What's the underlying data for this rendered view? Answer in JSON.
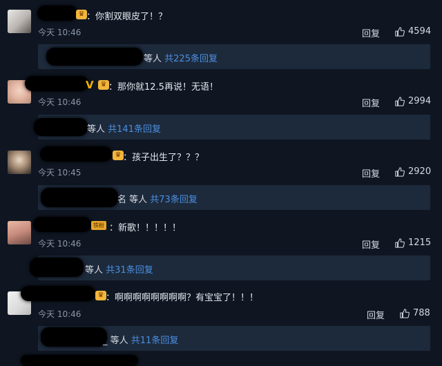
{
  "comments": [
    {
      "text": "：你割双眼皮了！？",
      "time": "今天 10:46",
      "reply_label": "回复",
      "likes": "4594",
      "thread": {
        "prefix": "等人",
        "count_text": "共225条回复"
      }
    },
    {
      "vip_mark": "V",
      "text": "：那你就12.5再说！无语！",
      "time": "今天 10:46",
      "reply_label": "回复",
      "likes": "2994",
      "thread": {
        "prefix": "等人",
        "count_text": "共141条回复"
      }
    },
    {
      "text": "：孩子出生了？？？",
      "time": "今天 10:45",
      "reply_label": "回复",
      "likes": "2920",
      "thread": {
        "prefix": "名 等人",
        "count_text": "共73条回复"
      }
    },
    {
      "fan_badge": "铁粉",
      "text": "：新歌！！！！！",
      "time": "今天 10:46",
      "reply_label": "回复",
      "likes": "1215",
      "thread": {
        "prefix": "等人",
        "count_text": "共31条回复"
      }
    },
    {
      "text": "：啊啊啊啊啊啊啊啊？有宝宝了！！！",
      "time": "今天 10:46",
      "reply_label": "回复",
      "likes": "788",
      "thread": {
        "prefix": "_ 等人",
        "count_text": "共11条回复"
      }
    }
  ],
  "icons": {
    "like": "thumbs-up-icon",
    "member_badge": "crown-badge-icon"
  },
  "colors": {
    "background": "#0f1622",
    "reply_box": "#1d2a3c",
    "link": "#4b8fe0",
    "badge": "#f2b63c"
  }
}
